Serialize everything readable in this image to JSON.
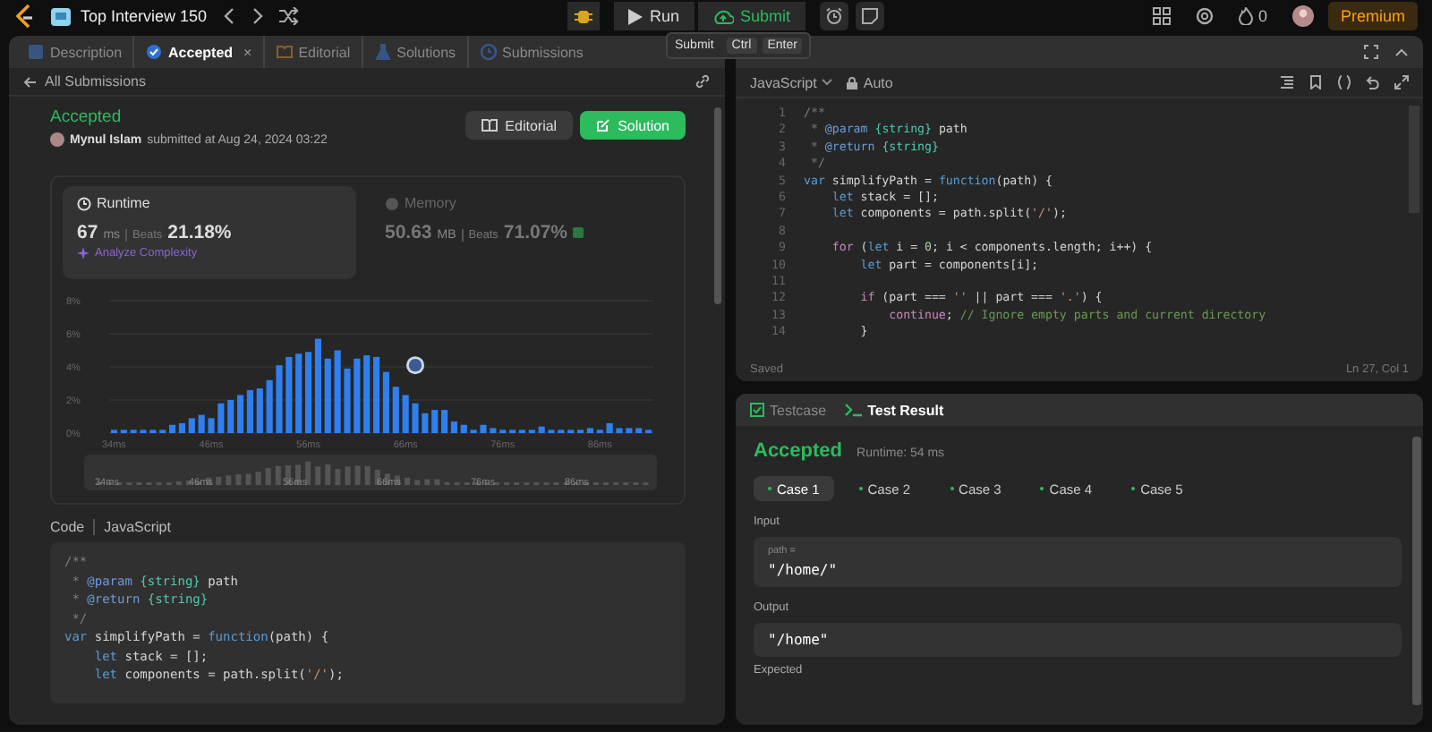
{
  "top_bar": {
    "problem_list": "Top Interview 150",
    "run": "Run",
    "submit": "Submit",
    "streak": "0",
    "premium": "Premium"
  },
  "left_panel": {
    "tabs": [
      {
        "label": "Description",
        "kind": "description",
        "selected": false
      },
      {
        "label": "Accepted",
        "kind": "accepted",
        "selected": true,
        "close": "×"
      },
      {
        "label": "Editorial",
        "kind": "editorial",
        "selected": false
      },
      {
        "label": "Solutions",
        "kind": "solutions",
        "selected": false
      },
      {
        "label": "Submissions",
        "kind": "submissions",
        "selected": false
      }
    ],
    "back_link": "All Submissions",
    "submission": {
      "status": "Accepted",
      "author": "Mynul Islam",
      "submitted": "submitted at Aug 24, 2024 03:22",
      "buttons": [
        {
          "label": "Editorial",
          "kind": "secondary"
        },
        {
          "label": "Solution",
          "kind": "primary"
        }
      ]
    },
    "stats": [
      {
        "title": "Runtime",
        "kind": "runtime",
        "value": "67",
        "unit": "ms",
        "beats_label": "Beats",
        "beats": "21.18%",
        "selected": true,
        "link": "Analyze Complexity"
      },
      {
        "title": "Memory",
        "kind": "memory",
        "value": "50.63",
        "unit": "MB",
        "beats_label": "Beats",
        "beats": "71.07%",
        "selected": false
      }
    ],
    "chart_data": {
      "type": "bar",
      "ylim": [
        0,
        8
      ],
      "grid": true,
      "categories": [
        "34ms",
        null,
        null,
        null,
        null,
        null,
        null,
        null,
        null,
        null,
        "46ms",
        null,
        null,
        null,
        null,
        null,
        null,
        null,
        null,
        null,
        "56ms",
        null,
        null,
        null,
        null,
        null,
        null,
        null,
        null,
        null,
        "66ms",
        null,
        null,
        null,
        null,
        null,
        null,
        null,
        null,
        null,
        "76ms",
        null,
        null,
        null,
        null,
        null,
        null,
        null,
        null,
        null,
        "86ms",
        null,
        null,
        null,
        null,
        null
      ],
      "values": [
        0.2,
        0.2,
        0.2,
        0.2,
        0.2,
        0.2,
        0.5,
        0.6,
        0.9,
        1.1,
        0.9,
        1.8,
        2.0,
        2.3,
        2.6,
        2.7,
        3.2,
        4.1,
        4.6,
        4.8,
        4.9,
        5.7,
        4.5,
        5.0,
        3.9,
        4.5,
        4.7,
        4.6,
        3.7,
        2.8,
        2.3,
        1.8,
        1.2,
        1.4,
        1.4,
        0.7,
        0.5,
        0.2,
        0.5,
        0.3,
        0.2,
        0.2,
        0.2,
        0.2,
        0.4,
        0.2,
        0.2,
        0.2,
        0.2,
        0.3,
        0.2,
        0.6,
        0.3,
        0.3,
        0.3,
        0.2
      ],
      "yticks": [
        {
          "value": 0,
          "label": "0%"
        },
        {
          "value": 2,
          "label": "2%"
        },
        {
          "value": 4,
          "label": "4%"
        },
        {
          "value": 6,
          "label": "6%"
        },
        {
          "value": 8,
          "label": "8%"
        }
      ]
    },
    "navigator": {
      "labels": [
        "34ms",
        "46ms",
        "56ms",
        "66ms",
        "76ms",
        "86ms"
      ]
    },
    "code_header": {
      "title": "Code",
      "language": "JavaScript"
    },
    "code": [
      {
        "tokens": [
          {
            "kind": "comment",
            "text": "/**"
          }
        ]
      },
      {
        "tokens": [
          {
            "kind": "comment",
            "text": " * "
          },
          {
            "kind": "tag",
            "text": "@param"
          },
          {
            "kind": "type",
            "text": " {string}"
          },
          {
            "kind": "plain",
            "text": " path"
          }
        ]
      },
      {
        "tokens": [
          {
            "kind": "comment",
            "text": " * "
          },
          {
            "kind": "tag",
            "text": "@return"
          },
          {
            "kind": "type",
            "text": " {string}"
          }
        ]
      },
      {
        "tokens": [
          {
            "kind": "comment",
            "text": " */"
          }
        ]
      },
      {
        "tokens": [
          {
            "kind": "keyword",
            "text": "var"
          },
          {
            "kind": "plain",
            "text": " simplifyPath = "
          },
          {
            "kind": "keyword",
            "text": "function"
          },
          {
            "kind": "plain",
            "text": "(path) {"
          }
        ]
      },
      {
        "tokens": [
          {
            "kind": "keyword",
            "text": "    let"
          },
          {
            "kind": "plain",
            "text": " stack = [];"
          }
        ]
      },
      {
        "tokens": [
          {
            "kind": "keyword",
            "text": "    let"
          },
          {
            "kind": "plain",
            "text": " components = path.split("
          },
          {
            "kind": "string",
            "text": "'/'"
          },
          {
            "kind": "plain",
            "text": ");"
          }
        ]
      }
    ]
  },
  "tooltip": {
    "label": "Submit",
    "keys": [
      "Ctrl",
      "Enter"
    ]
  },
  "editor": {
    "language": "JavaScript",
    "mode": "Auto",
    "status": "Saved",
    "cursor": "Ln 27, Col 1",
    "lines": [
      {
        "number": "1",
        "tokens": [
          {
            "kind": "comment",
            "text": "/**"
          }
        ]
      },
      {
        "number": "2",
        "tokens": [
          {
            "kind": "comment",
            "text": " * "
          },
          {
            "kind": "tag",
            "text": "@param"
          },
          {
            "kind": "type",
            "text": " {string}"
          },
          {
            "kind": "plain",
            "text": " path"
          }
        ]
      },
      {
        "number": "3",
        "tokens": [
          {
            "kind": "comment",
            "text": " * "
          },
          {
            "kind": "tag",
            "text": "@return"
          },
          {
            "kind": "type",
            "text": " {string}"
          }
        ]
      },
      {
        "number": "4",
        "tokens": [
          {
            "kind": "comment",
            "text": " */"
          }
        ]
      },
      {
        "number": "5",
        "tokens": [
          {
            "kind": "keyword",
            "text": "var"
          },
          {
            "kind": "plain",
            "text": " simplifyPath = "
          },
          {
            "kind": "keyword",
            "text": "function"
          },
          {
            "kind": "plain",
            "text": "(path) {"
          }
        ]
      },
      {
        "number": "6",
        "tokens": [
          {
            "kind": "keyword",
            "text": "    let"
          },
          {
            "kind": "plain",
            "text": " stack = [];"
          }
        ]
      },
      {
        "number": "7",
        "tokens": [
          {
            "kind": "keyword",
            "text": "    let"
          },
          {
            "kind": "plain",
            "text": " components = path.split("
          },
          {
            "kind": "string",
            "text": "'/'"
          },
          {
            "kind": "plain",
            "text": ");"
          }
        ]
      },
      {
        "number": "8"
      },
      {
        "number": "9",
        "tokens": [
          {
            "kind": "control",
            "text": "    for"
          },
          {
            "kind": "plain",
            "text": " ("
          },
          {
            "kind": "keyword",
            "text": "let"
          },
          {
            "kind": "plain",
            "text": " i = "
          },
          {
            "kind": "number",
            "text": "0"
          },
          {
            "kind": "plain",
            "text": "; i < components.length; i++) {"
          }
        ]
      },
      {
        "number": "10",
        "tokens": [
          {
            "kind": "keyword",
            "text": "        let"
          },
          {
            "kind": "plain",
            "text": " part = components[i];"
          }
        ]
      },
      {
        "number": "11"
      },
      {
        "number": "12",
        "tokens": [
          {
            "kind": "control",
            "text": "        if"
          },
          {
            "kind": "plain",
            "text": " (part === "
          },
          {
            "kind": "string",
            "text": "''"
          },
          {
            "kind": "plain",
            "text": " || part === "
          },
          {
            "kind": "string",
            "text": "'.'"
          },
          {
            "kind": "plain",
            "text": ") {"
          }
        ]
      },
      {
        "number": "13",
        "tokens": [
          {
            "kind": "control",
            "text": "            continue"
          },
          {
            "kind": "plain",
            "text": "; "
          },
          {
            "kind": "linecomment",
            "text": "// Ignore empty parts and current directory"
          }
        ]
      },
      {
        "number": "14",
        "tokens": [
          {
            "kind": "plain",
            "text": "        }"
          }
        ]
      }
    ]
  },
  "result_panel": {
    "tabs": [
      {
        "label": "Testcase",
        "kind": "testcase",
        "selected": false
      },
      {
        "label": "Test Result",
        "kind": "result",
        "selected": true
      }
    ],
    "verdict": "Accepted",
    "runtime": "Runtime: 54 ms",
    "cases": [
      {
        "label": "Case 1",
        "selected": true,
        "passed": true
      },
      {
        "label": "Case 2",
        "selected": false,
        "passed": true
      },
      {
        "label": "Case 3",
        "selected": false,
        "passed": true
      },
      {
        "label": "Case 4",
        "selected": false,
        "passed": true
      },
      {
        "label": "Case 5",
        "selected": false,
        "passed": true
      }
    ],
    "sections": [
      {
        "label": "Input",
        "param": "path =",
        "value": "\"/home/\""
      },
      {
        "label": "Output",
        "value": "\"/home\""
      }
    ],
    "next_label": "Expected"
  }
}
